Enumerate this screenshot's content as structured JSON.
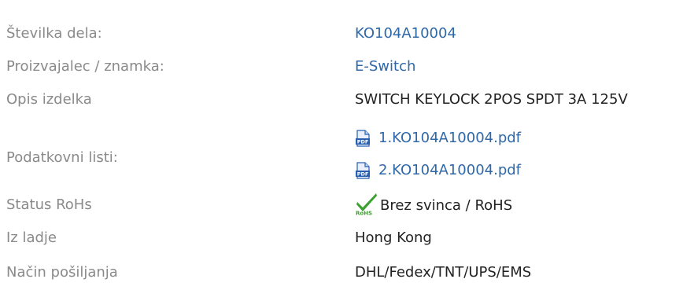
{
  "rows": {
    "part_number": {
      "label": "Številka dela:",
      "value": "KO104A10004"
    },
    "manufacturer": {
      "label": "Proizvajalec / znamka:",
      "value": "E-Switch"
    },
    "description": {
      "label": "Opis izdelka",
      "value": "SWITCH KEYLOCK 2POS SPDT 3A 125V"
    },
    "datasheets": {
      "label": "Podatkovni listi:",
      "files": [
        {
          "name": "1.KO104A10004.pdf"
        },
        {
          "name": "2.KO104A10004.pdf"
        }
      ]
    },
    "rohs": {
      "label": "Status RoHs",
      "value": "Brez svinca / RoHS"
    },
    "ships_from": {
      "label": "Iz ladje",
      "value": "Hong Kong"
    },
    "shipping": {
      "label": "Način pošiljanja",
      "value": "DHL/Fedex/TNT/UPS/EMS"
    }
  },
  "icons": {
    "pdf": "pdf-file-icon",
    "rohs": "rohs-check-icon"
  },
  "colors": {
    "label": "#8a8a8a",
    "link": "#2f68a8",
    "value": "#222222",
    "check": "#3aa02f",
    "pdf": "#2a5fb0"
  }
}
